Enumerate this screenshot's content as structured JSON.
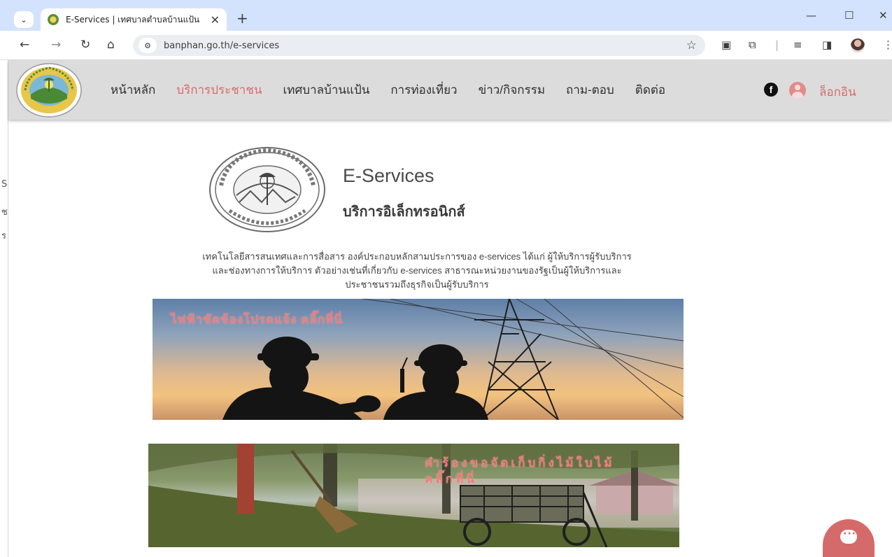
{
  "browser": {
    "tab_title": "E-Services | เทศบาลตำบลบ้านแป้น",
    "tab_close": "✕",
    "new_tab": "+",
    "url": "banphan.go.th/e-services",
    "window_controls": {
      "minimize": "—",
      "maximize": "☐",
      "close": "✕"
    }
  },
  "icons": {
    "back": "back-arrow-icon",
    "forward": "forward-arrow-icon",
    "reload": "reload-icon",
    "home": "home-icon",
    "site_info": "site-settings-icon",
    "bookmark": "star-icon",
    "extensions": "puzzle-icon",
    "media": "media-control-icon",
    "sidepanel": "side-panel-icon",
    "menu": "kebab-menu-icon",
    "facebook": "facebook-icon",
    "user": "user-avatar-icon",
    "chat": "chat-bubble-icon"
  },
  "header": {
    "logo_text_top": "เทศบาลตำบลบ้านแป้น",
    "logo_text_bottom": "จังหวัดลำพูน",
    "nav": [
      {
        "label": "หน้าหลัก",
        "active": false
      },
      {
        "label": "บริการประชาชน",
        "active": true
      },
      {
        "label": "เทศบาลบ้านแป้น",
        "active": false
      },
      {
        "label": "การท่องเที่ยว",
        "active": false
      },
      {
        "label": "ข่าว/กิจกรรม",
        "active": false
      },
      {
        "label": "ถาม-ตอบ",
        "active": false
      },
      {
        "label": "ติดต่อ",
        "active": false
      }
    ],
    "login_label": "ล็อกอิน"
  },
  "hero": {
    "seal_text_top": "เทศบาลตำบลบ้านแป้น",
    "seal_text_bottom": "จังหวัดลำพูน",
    "title": "E-Services",
    "subtitle": "บริการอิเล็กทรอนิกส์",
    "intro_lines": [
      "เทคโนโลยีสารสนเทศและการสื่อสาร องค์ประกอบหลักสามประการของ e-services ได้แก่ ผู้ให้บริการผู้รับบริการ",
      "และช่องทางการให้บริการ ตัวอย่างเช่นที่เกี่ยวกับ e-services สาธารณะหน่วยงานของรัฐเป็นผู้ให้บริการและ",
      "ประชาชนรวมถึงธุรกิจเป็นผู้รับบริการ"
    ]
  },
  "banners": [
    {
      "cta": "ไฟฟ้าขัดข้องโปรดแจ้ง คลิ๊กที่นี่"
    },
    {
      "cta_line1": "คำร้องขอจัดเก็บกิ่งไม้ใบไม้",
      "cta_line2": "คลิ๊กที่นี่"
    }
  ],
  "colors": {
    "accent": "#d96b6b",
    "header_bg": "#dcdcdc",
    "chat_button": "#d56a6a",
    "banner_cta": "#f47a7a"
  }
}
